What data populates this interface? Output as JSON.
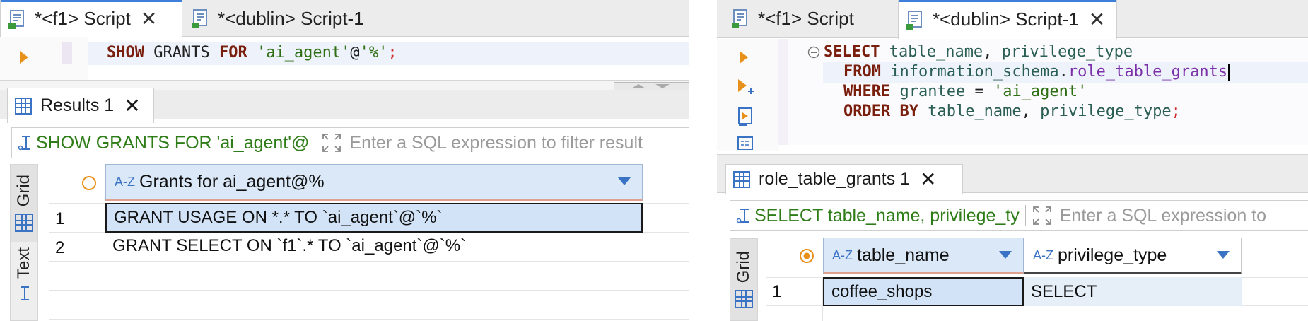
{
  "left": {
    "tabs": [
      {
        "label": "*<f1> Script",
        "active": true
      },
      {
        "label": "*<dublin> Script-1",
        "active": false
      }
    ],
    "editor": {
      "kw1": "SHOW",
      "t1": " GRANTS ",
      "kw2": "FOR",
      "s1": " 'ai_agent'",
      "t2": "@",
      "s2": "'%'",
      "semi": ";"
    },
    "results_tab": "Results 1",
    "filter_query": "SHOW GRANTS FOR 'ai_agent'@",
    "filter_placeholder": "Enter a SQL expression to filter result",
    "side_labels": {
      "grid": "Grid",
      "text": "Text"
    },
    "column": "Grants for ai_agent@%",
    "rows": [
      {
        "num": "1",
        "value": "GRANT USAGE ON *.* TO `ai_agent`@`%`"
      },
      {
        "num": "2",
        "value": "GRANT SELECT ON `f1`.* TO `ai_agent`@`%`"
      }
    ]
  },
  "right": {
    "tabs": [
      {
        "label": "*<f1> Script",
        "active": false
      },
      {
        "label": "*<dublin> Script-1",
        "active": true
      }
    ],
    "editor": {
      "l1kw": "SELECT",
      "l1a": " table_name",
      "l1b": ", ",
      "l1c": "privilege_type",
      "l2kw": "FROM",
      "l2a": " information_schema",
      "l2b": ".",
      "l2c": "role_table_grants",
      "l3kw": "WHERE",
      "l3a": " grantee",
      "l3b": " = ",
      "l3c": "'ai_agent'",
      "l4kw": "ORDER BY",
      "l4a": " table_name",
      "l4b": ", ",
      "l4c": "privilege_type",
      "l4d": ";"
    },
    "results_tab": "role_table_grants 1",
    "filter_query": "SELECT table_name, privilege_ty",
    "filter_placeholder": "Enter a SQL expression to",
    "side_labels": {
      "grid": "Grid"
    },
    "columns": [
      "table_name",
      "privilege_type"
    ],
    "rows": [
      {
        "num": "1",
        "table_name": "coffee_shops",
        "privilege_type": "SELECT"
      }
    ]
  },
  "colors": {
    "accent": "#3b73c4",
    "string": "#2f6f13",
    "keyword": "#7a1f0e",
    "filter_query": "#2e7d18",
    "selected": "#d3e3f7"
  }
}
